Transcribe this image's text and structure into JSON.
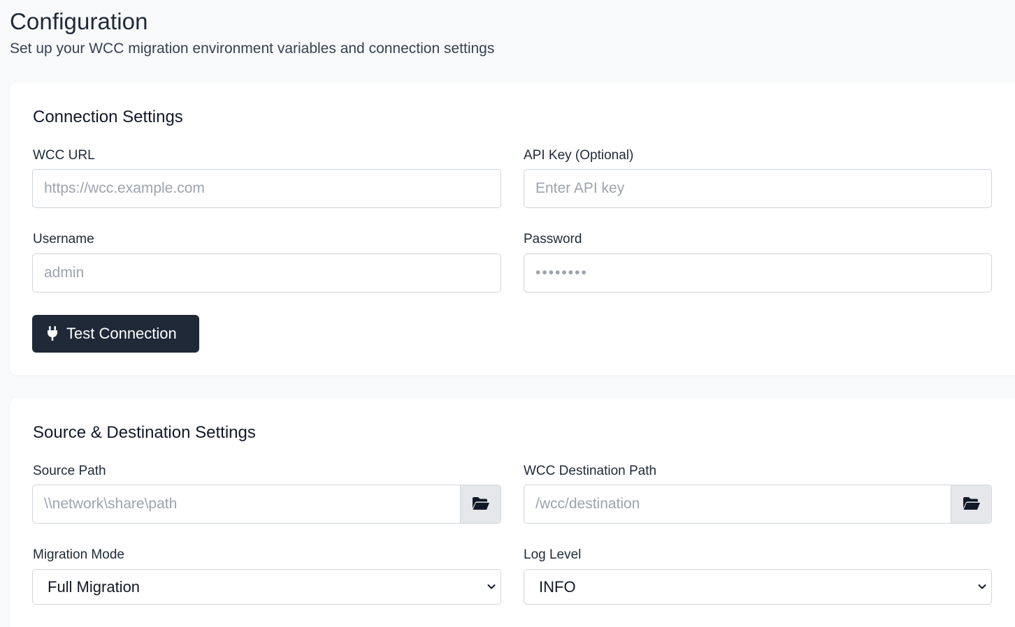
{
  "header": {
    "title": "Configuration",
    "subtitle": "Set up your WCC migration environment variables and connection settings"
  },
  "connection": {
    "title": "Connection Settings",
    "wcc_url": {
      "label": "WCC URL",
      "placeholder": "https://wcc.example.com",
      "value": ""
    },
    "api_key": {
      "label": "API Key (Optional)",
      "placeholder": "Enter API key",
      "value": ""
    },
    "username": {
      "label": "Username",
      "placeholder": "admin",
      "value": ""
    },
    "password": {
      "label": "Password",
      "placeholder": "••••••••",
      "value": ""
    },
    "test_button": {
      "label": "Test Connection",
      "icon": "plug-icon"
    }
  },
  "source_dest": {
    "title": "Source & Destination Settings",
    "source_path": {
      "label": "Source Path",
      "placeholder": "\\\\network\\share\\path",
      "value": "",
      "browse_icon": "folder-open-icon"
    },
    "dest_path": {
      "label": "WCC Destination Path",
      "placeholder": "/wcc/destination",
      "value": "",
      "browse_icon": "folder-open-icon"
    },
    "migration_mode": {
      "label": "Migration Mode",
      "selected": "Full Migration"
    },
    "log_level": {
      "label": "Log Level",
      "selected": "INFO"
    }
  },
  "colors": {
    "page_bg": "#f8f9fb",
    "card_bg": "#ffffff",
    "primary_button": "#1f2937",
    "input_border": "#d1d5db",
    "placeholder": "#9ca3af",
    "addon_bg": "#e5e7eb"
  }
}
